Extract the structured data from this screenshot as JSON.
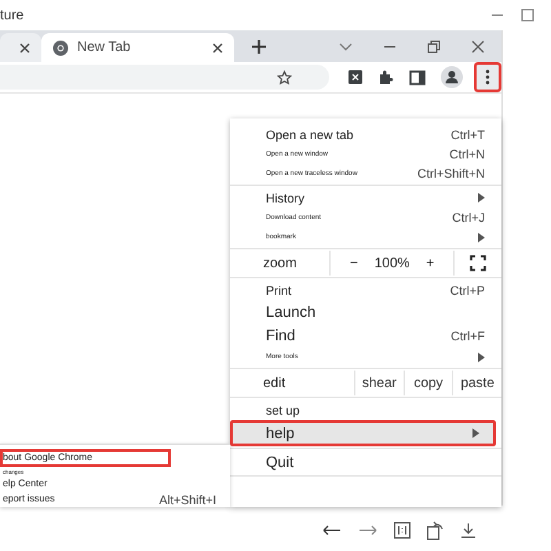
{
  "app_title": "ture",
  "tabs": [
    {
      "kind": "cut",
      "selected": false
    },
    {
      "kind": "page",
      "title": "New Tab",
      "selected": true
    }
  ],
  "menu_button": {
    "outlined": true
  },
  "menu": {
    "sections": [
      [
        {
          "kind": "item",
          "label": "Open a new tab",
          "shortcut": "Ctrl+T",
          "submenu": false,
          "selected": false,
          "outlined": false
        },
        {
          "kind": "minor",
          "label": "Open a new window",
          "shortcut": "Ctrl+N",
          "submenu": false,
          "selected": false,
          "outlined": false
        },
        {
          "kind": "minor",
          "label": "Open a new traceless window",
          "shortcut": "Ctrl+Shift+N",
          "submenu": false,
          "selected": false,
          "outlined": false
        }
      ],
      [
        {
          "kind": "item",
          "label": "History",
          "submenu": true,
          "selected": false,
          "outlined": false
        },
        {
          "kind": "minor",
          "label": "Download content",
          "shortcut": "Ctrl+J",
          "submenu": false,
          "selected": false,
          "outlined": false
        },
        {
          "kind": "minor",
          "label": "bookmark",
          "submenu": true,
          "selected": false,
          "outlined": false
        }
      ],
      [
        {
          "kind": "zoom",
          "label": "zoom",
          "minus": "−",
          "value": "100%",
          "plus": "+"
        }
      ],
      [
        {
          "kind": "item",
          "label": "Print",
          "shortcut": "Ctrl+P",
          "submenu": false,
          "selected": false,
          "outlined": false
        },
        {
          "kind": "large",
          "label": "Launch",
          "submenu": false,
          "selected": false,
          "outlined": false
        },
        {
          "kind": "large",
          "label": "Find",
          "shortcut": "Ctrl+F",
          "submenu": false,
          "selected": false,
          "outlined": false
        },
        {
          "kind": "minor",
          "label": "More tools",
          "submenu": true,
          "selected": false,
          "outlined": false
        }
      ],
      [
        {
          "kind": "edit",
          "label": "edit",
          "actions": [
            "shear",
            "copy",
            "paste"
          ]
        }
      ],
      [
        {
          "kind": "item",
          "label": "set up",
          "submenu": false,
          "selected": false,
          "outlined": false
        },
        {
          "kind": "large",
          "label": "help",
          "submenu": true,
          "selected": true,
          "outlined": true
        }
      ],
      [
        {
          "kind": "large",
          "label": "Quit",
          "submenu": false,
          "selected": false,
          "outlined": false
        }
      ]
    ]
  },
  "help_submenu": [
    {
      "kind": "item",
      "label": "bout Google Chrome",
      "outlined": true
    },
    {
      "kind": "minor",
      "label": "changes",
      "outlined": false
    },
    {
      "kind": "item",
      "label": "elp Center",
      "outlined": false
    },
    {
      "kind": "item",
      "label": "eport issues",
      "shortcut": "Alt+Shift+I",
      "outlined": false
    }
  ]
}
